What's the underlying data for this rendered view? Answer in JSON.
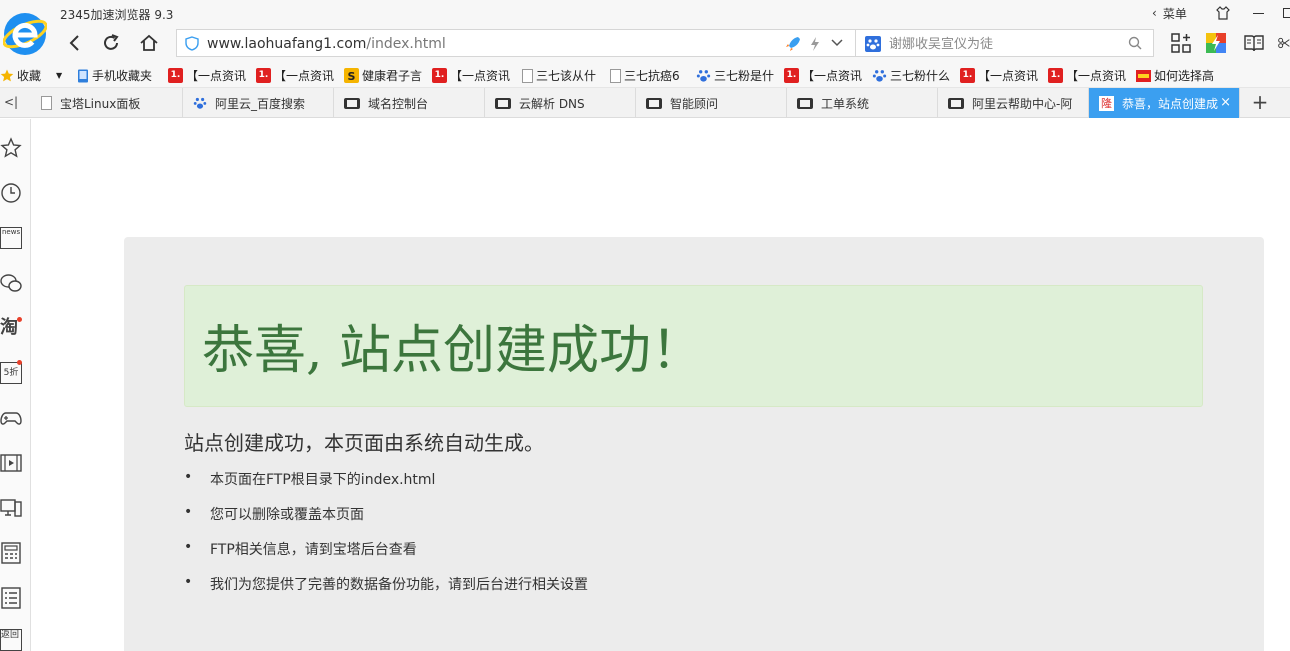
{
  "app": {
    "title": "2345加速浏览器 9.3",
    "menu_label": "菜单"
  },
  "address": {
    "domain": "www.laohuafang1.com",
    "path": "/index.html"
  },
  "search": {
    "placeholder": "谢娜收吴宣仪为徒"
  },
  "bookmarks": {
    "favorites_label": "收藏",
    "items": [
      {
        "label": "手机收藏夹",
        "icon": "phone-icon"
      },
      {
        "label": "【一点资讯",
        "icon": "yidian-icon"
      },
      {
        "label": "【一点资讯",
        "icon": "yidian-icon"
      },
      {
        "label": "健康君子言",
        "icon": "sogou-icon"
      },
      {
        "label": "【一点资讯",
        "icon": "yidian-icon"
      },
      {
        "label": "三七该从什",
        "icon": "doc-icon"
      },
      {
        "label": "三七抗癌6",
        "icon": "doc-icon"
      },
      {
        "label": "三七粉是什",
        "icon": "baidu-paw-icon"
      },
      {
        "label": "【一点资讯",
        "icon": "yidian-icon"
      },
      {
        "label": "三七粉什么",
        "icon": "baidu-paw-icon"
      },
      {
        "label": "【一点资讯",
        "icon": "yidian-icon"
      },
      {
        "label": "【一点资讯",
        "icon": "yidian-icon"
      },
      {
        "label": "如何选择高",
        "icon": "site-icon"
      }
    ],
    "badge_text": "1."
  },
  "tabs": [
    {
      "label": "宝塔Linux面板",
      "icon": "doc-icon"
    },
    {
      "label": "阿里云_百度搜索",
      "icon": "baidu-paw-icon"
    },
    {
      "label": "域名控制台",
      "icon": "aliyun-icon"
    },
    {
      "label": "云解析 DNS",
      "icon": "aliyun-icon"
    },
    {
      "label": "智能顾问",
      "icon": "aliyun-icon"
    },
    {
      "label": "工单系统",
      "icon": "aliyun-icon"
    },
    {
      "label": "阿里云帮助中心-阿",
      "icon": "aliyun-icon"
    },
    {
      "label": "恭喜，站点创建成",
      "icon": "site-icon",
      "active": true
    }
  ],
  "active_tab_close": "×",
  "site_icon_glyph": "隆",
  "sidebar": {
    "icons": [
      "star-icon",
      "clock-icon",
      "news-icon",
      "wechat-icon",
      "taobao-icon",
      "discount-icon",
      "gamepad-icon",
      "video-icon",
      "computer-icon",
      "calculator-icon",
      "list-icon",
      "back-icon"
    ],
    "news_text": "news",
    "taobao_text": "淘",
    "discount_text": "5折",
    "back_text": "返回"
  },
  "page": {
    "jumbotron_title": "恭喜, 站点创建成功！",
    "lead": "站点创建成功，本页面由系统自动生成。",
    "items": [
      "本页面在FTP根目录下的index.html",
      "您可以删除或覆盖本页面",
      "FTP相关信息，请到宝塔后台查看",
      "我们为您提供了完善的数据备份功能，请到后台进行相关设置"
    ]
  },
  "colors": {
    "tab_active": "#3b9ff0",
    "jumbotron_bg": "#dff0d8",
    "jumbotron_text": "#3c763d",
    "container_bg": "#ececec",
    "badge_red": "#e02020"
  }
}
